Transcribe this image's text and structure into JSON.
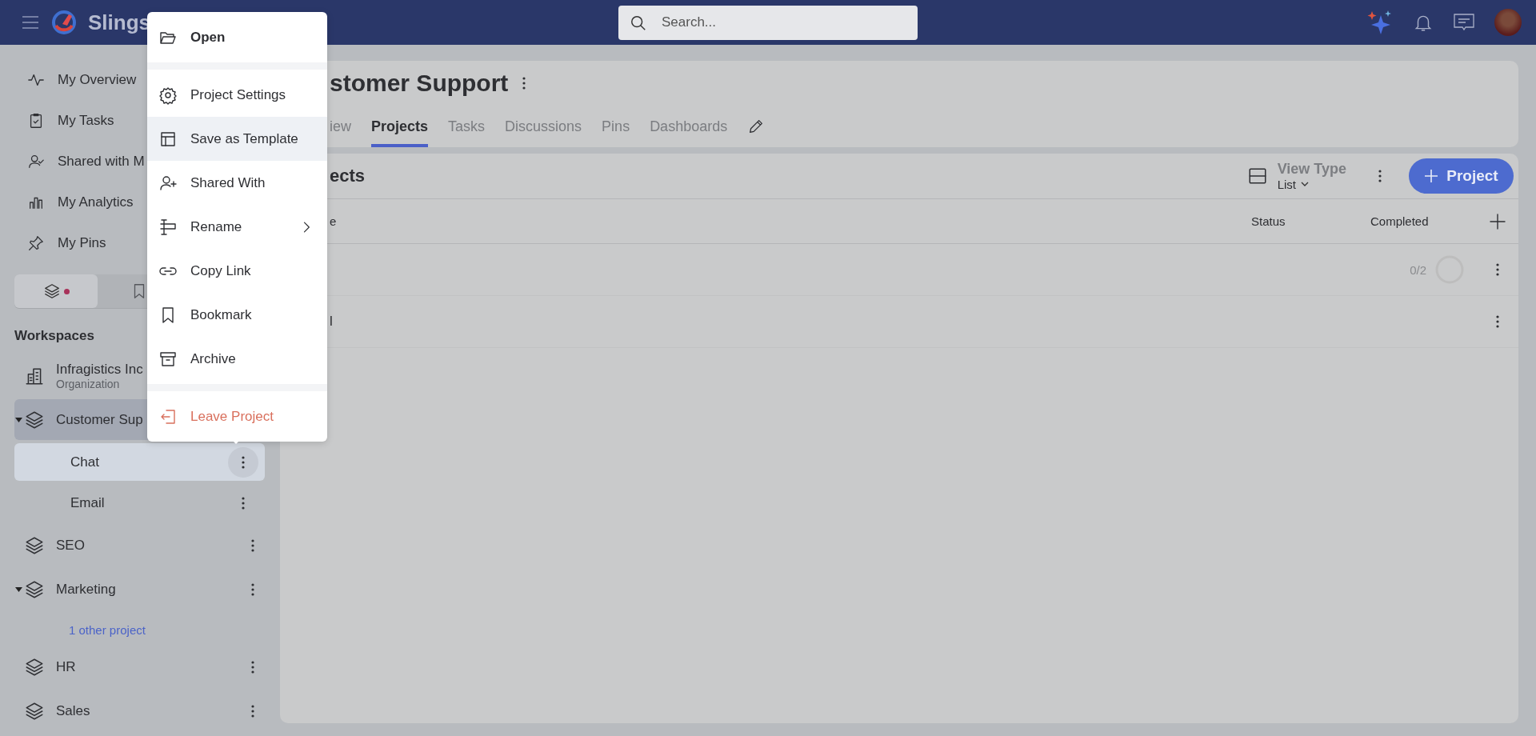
{
  "topbar": {
    "brand": "Slings",
    "search_placeholder": "Search..."
  },
  "sidebar": {
    "nav": [
      {
        "label": "My Overview"
      },
      {
        "label": "My Tasks"
      },
      {
        "label": "Shared with M"
      },
      {
        "label": "My Analytics"
      },
      {
        "label": "My Pins"
      }
    ],
    "view_tabs": [
      {
        "selected": true,
        "badge": true
      },
      {
        "selected": false,
        "badge": false
      }
    ],
    "section_title": "Workspaces",
    "workspaces": [
      {
        "kind": "organization",
        "name": "Infragistics Inc",
        "subtitle": "Organization",
        "selected": false,
        "expanded": false
      },
      {
        "kind": "workspace",
        "name": "Customer Sup",
        "selected": true,
        "expanded": true,
        "children": [
          {
            "name": "Chat",
            "selected": true
          },
          {
            "name": "Email",
            "selected": false
          }
        ]
      },
      {
        "kind": "workspace",
        "name": "SEO",
        "selected": false,
        "expanded": false
      },
      {
        "kind": "workspace",
        "name": "Marketing",
        "selected": false,
        "expanded": true,
        "more_link": "1 other project"
      },
      {
        "kind": "workspace",
        "name": "HR",
        "selected": false,
        "expanded": false
      },
      {
        "kind": "workspace",
        "name": "Sales",
        "selected": false,
        "expanded": false
      }
    ]
  },
  "context_menu": {
    "groups": [
      [
        {
          "label": "Open",
          "kind": "bold",
          "highlighted": false,
          "submenu": false
        }
      ],
      [
        {
          "label": "Project Settings",
          "kind": "normal",
          "highlighted": false,
          "submenu": false
        },
        {
          "label": "Save as Template",
          "kind": "normal",
          "highlighted": true,
          "submenu": false
        },
        {
          "label": "Shared With",
          "kind": "normal",
          "highlighted": false,
          "submenu": false
        },
        {
          "label": "Rename",
          "kind": "normal",
          "highlighted": false,
          "submenu": true
        },
        {
          "label": "Copy Link",
          "kind": "normal",
          "highlighted": false,
          "submenu": false
        },
        {
          "label": "Bookmark",
          "kind": "normal",
          "highlighted": false,
          "submenu": false
        },
        {
          "label": "Archive",
          "kind": "normal",
          "highlighted": false,
          "submenu": false
        }
      ],
      [
        {
          "label": "Leave Project",
          "kind": "danger",
          "highlighted": false,
          "submenu": false
        }
      ]
    ]
  },
  "main": {
    "title": "stomer Support",
    "tabs": [
      {
        "label": "iew",
        "selected": false
      },
      {
        "label": "Projects",
        "selected": true
      },
      {
        "label": "Tasks",
        "selected": false
      },
      {
        "label": "Discussions",
        "selected": false
      },
      {
        "label": "Pins",
        "selected": false
      },
      {
        "label": "Dashboards",
        "selected": false
      }
    ],
    "section_title": "ects",
    "view_type": {
      "label": "View Type",
      "value": "List"
    },
    "add_button": "Project",
    "table": {
      "columns": [
        "e",
        "Status",
        "Completed"
      ],
      "rows": [
        {
          "completed": "0/2"
        },
        {
          "name": "l"
        }
      ]
    }
  }
}
